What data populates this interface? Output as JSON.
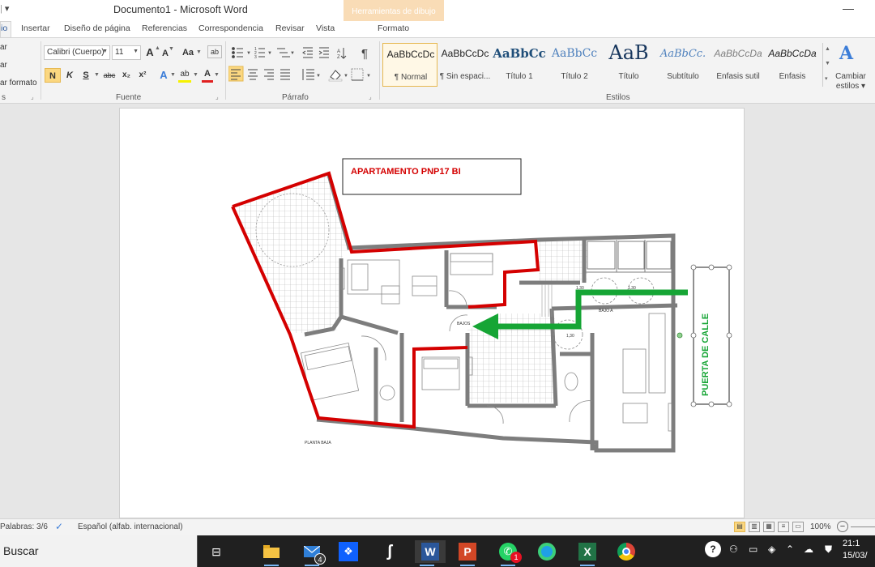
{
  "window": {
    "qat_glyph": "▾",
    "doc_title": "Documento1 - Microsoft Word",
    "contextual_tab_group": "Herramientas de dibujo",
    "minimize_glyph": "—"
  },
  "tabs": {
    "inicio_partial": "io",
    "insertar": "Insertar",
    "diseno": "Diseño de página",
    "referencias": "Referencias",
    "correspondencia": "Correspondencia",
    "revisar": "Revisar",
    "vista": "Vista",
    "formato": "Formato"
  },
  "ribbon": {
    "clipboard": {
      "item1": "ar",
      "item2": "ar",
      "item3": "ar formato",
      "label_partial": "s"
    },
    "font": {
      "family": "Calibri (Cuerpo)",
      "size": "11",
      "grow": "A",
      "shrink": "A",
      "change_case": "Aa",
      "clear": "ab",
      "bold": "N",
      "italic": "K",
      "underline": "S",
      "strike": "abc",
      "subscript": "x₂",
      "superscript": "x²",
      "effects": "A",
      "highlight": "ab",
      "color": "A",
      "label": "Fuente"
    },
    "paragraph": {
      "pilcrow": "¶",
      "label": "Párrafo"
    },
    "styles": {
      "label": "Estilos",
      "items": [
        {
          "sample": "AaBbCcDc",
          "name": "¶ Normal"
        },
        {
          "sample": "AaBbCcDc",
          "name": "¶ Sin espaci..."
        },
        {
          "sample": "AaBbCc",
          "name": "Título 1"
        },
        {
          "sample": "AaBbCc",
          "name": "Título 2"
        },
        {
          "sample": "AaB",
          "name": "Título"
        },
        {
          "sample": "AaBbCc.",
          "name": "Subtítulo"
        },
        {
          "sample": "AaBbCcDa",
          "name": "Énfasis sutil"
        },
        {
          "sample": "AaBbCcDa",
          "name": "Énfasis"
        }
      ],
      "change_styles_icon": "A",
      "change_styles_line1": "Cambiar",
      "change_styles_line2": "estilos ▾"
    }
  },
  "document": {
    "title_box_text": "APARTAMENTO PNP17 BI",
    "street_door_text": "PUERTA DE CALLE",
    "floor_label": "PLANTA BAJA",
    "label_bajo": "BAJOS",
    "label_bajo_a": "BAJO A",
    "dim_1": "1,30",
    "dim_2": "1,30",
    "dim_3": "1,30",
    "colors": {
      "outline_red": "#d40000",
      "arrow_green": "#16a535",
      "wall_gray": "#7d7d7d"
    }
  },
  "statusbar": {
    "words": "Palabras: 3/6",
    "language": "Español (alfab. internacional)",
    "zoom": "100%",
    "zoom_out": "−"
  },
  "taskbar": {
    "search": "Buscar",
    "mail_badge": "4",
    "whatsapp_badge": "1",
    "clock_time": "21:1",
    "clock_date": "15/03/"
  }
}
